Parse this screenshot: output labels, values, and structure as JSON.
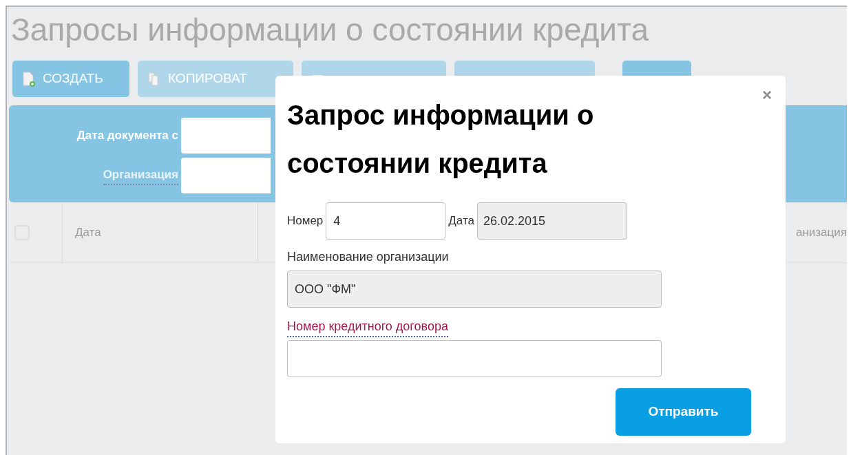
{
  "page": {
    "title": "Запросы информации о состоянии кредита"
  },
  "toolbar": [
    {
      "kind": "create",
      "label": "СОЗДАТЬ",
      "disabled": false
    },
    {
      "kind": "copy",
      "label": "КОПИРОВАТ",
      "disabled": true
    },
    {
      "kind": "sign",
      "disabled": true
    },
    {
      "kind": "send",
      "disabled": true
    },
    {
      "kind": "more",
      "disabled": false
    }
  ],
  "filters": [
    {
      "label": "Дата документа с",
      "link": false
    },
    {
      "label": "Организация",
      "link": true
    }
  ],
  "table": {
    "columns": [
      {
        "kind": "check",
        "checked": false
      },
      {
        "kind": "text",
        "label": "Дата"
      },
      {
        "kind": "text"
      },
      {
        "kind": "text",
        "label": "анизация"
      }
    ]
  },
  "dialog": {
    "title": "Запрос информации о состоянии кредита",
    "number_label": "Номер",
    "number_value": "4",
    "date_label": "Дата",
    "date_value": "26.02.2015",
    "org_label": "Наименование организации",
    "org_value": "ООО \"ФМ\"",
    "close": "×",
    "contract_label": "Номер кредитного договора",
    "submit": "Отправить"
  }
}
